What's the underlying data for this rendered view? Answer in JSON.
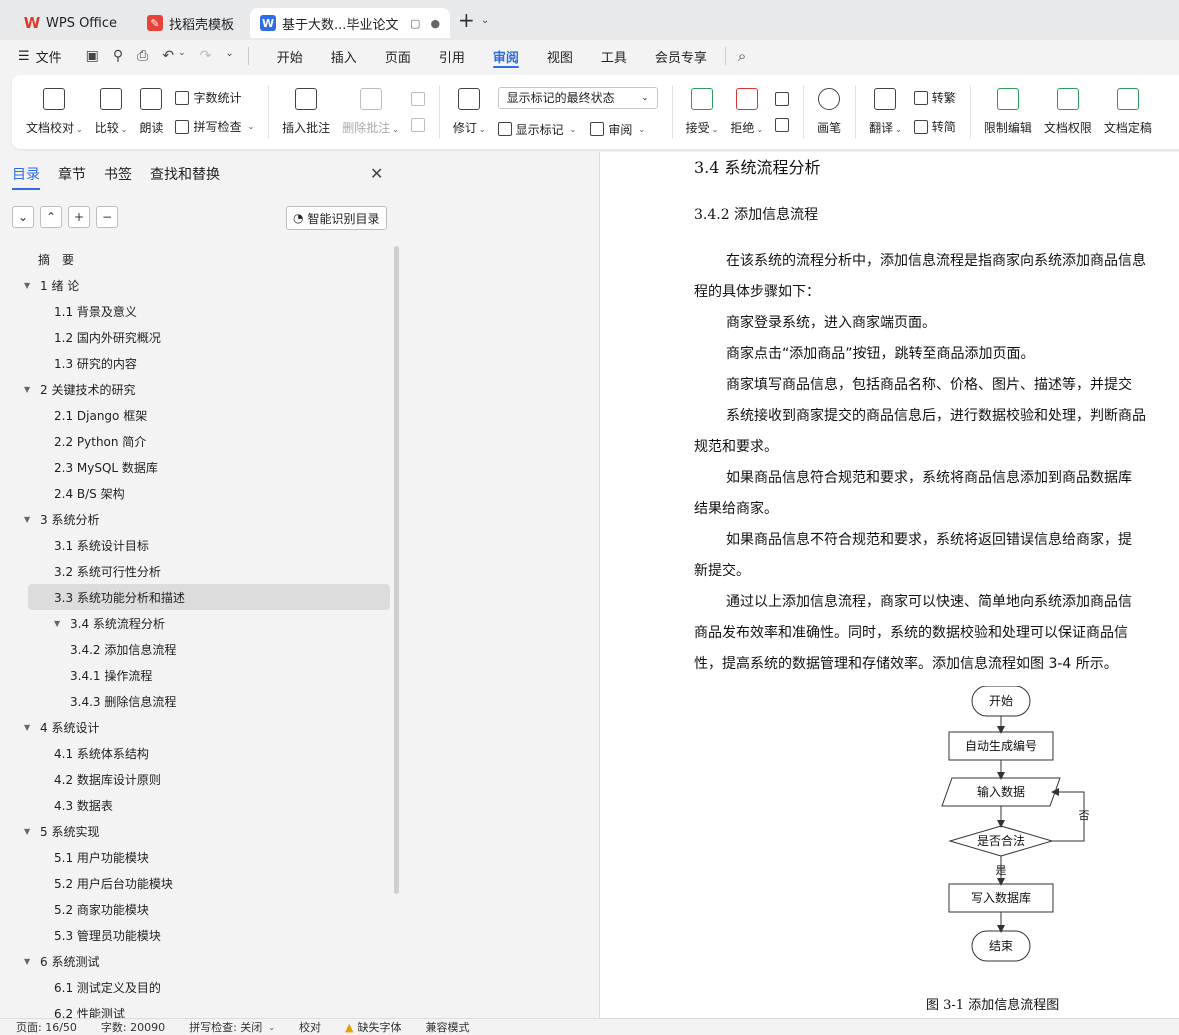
{
  "tabs": [
    {
      "label": "WPS Office",
      "icon": "wps-logo-icon"
    },
    {
      "label": "找稻壳模板",
      "icon": "docer-logo-icon"
    },
    {
      "label": "基于大数...毕业论文",
      "icon": "word-doc-icon"
    }
  ],
  "menu": {
    "file": "文件",
    "items": [
      "开始",
      "插入",
      "页面",
      "引用",
      "审阅",
      "视图",
      "工具",
      "会员专享"
    ],
    "active": "审阅"
  },
  "ribbon": {
    "doc_check": "文档校对",
    "compare": "比较",
    "read_aloud": "朗读",
    "word_count": "字数统计",
    "spell_check": "拼写检查",
    "insert_comment": "插入批注",
    "delete_comment": "删除批注",
    "revise": "修订",
    "markup_select": "显示标记的最终状态",
    "show_markup": "显示标记",
    "review": "审阅",
    "accept": "接受",
    "reject": "拒绝",
    "pen": "画笔",
    "translate": "翻译",
    "to_traditional": "转繁",
    "to_simplified": "转简",
    "restrict_edit": "限制编辑",
    "doc_permission": "文档权限",
    "doc_finalize": "文档定稿"
  },
  "sidepanel": {
    "tabs": [
      "目录",
      "章节",
      "书签",
      "查找和替换"
    ],
    "active_tab": "目录",
    "smart_toc": "智能识别目录",
    "toc": [
      {
        "label": "摘　要",
        "level": 1,
        "arrow": false
      },
      {
        "label": "1  绪 论",
        "level": 1,
        "arrow": true
      },
      {
        "label": "1.1 背景及意义",
        "level": 2
      },
      {
        "label": "1.2 国内外研究概况",
        "level": 2
      },
      {
        "label": "1.3 研究的内容",
        "level": 2
      },
      {
        "label": "2  关键技术的研究",
        "level": 1,
        "arrow": true
      },
      {
        "label": "2.1 Django 框架",
        "level": 2
      },
      {
        "label": "2.2 Python 简介",
        "level": 2
      },
      {
        "label": "2.3 MySQL 数据库",
        "level": 2
      },
      {
        "label": "2.4 B/S 架构",
        "level": 2
      },
      {
        "label": "3  系统分析",
        "level": 1,
        "arrow": true
      },
      {
        "label": "3.1  系统设计目标",
        "level": 2
      },
      {
        "label": "3.2  系统可行性分析",
        "level": 2
      },
      {
        "label": "3.3  系统功能分析和描述",
        "level": 2,
        "selected": true
      },
      {
        "label": "3.4 系统流程分析",
        "level": 2,
        "arrow": true
      },
      {
        "label": "3.4.2 添加信息流程",
        "level": 3
      },
      {
        "label": "3.4.1 操作流程",
        "level": 3
      },
      {
        "label": "3.4.3 删除信息流程",
        "level": 3
      },
      {
        "label": "4  系统设计",
        "level": 1,
        "arrow": true
      },
      {
        "label": "4.1  系统体系结构",
        "level": 2
      },
      {
        "label": "4.2  数据库设计原则",
        "level": 2
      },
      {
        "label": "4.3  数据表",
        "level": 2
      },
      {
        "label": "5  系统实现",
        "level": 1,
        "arrow": true
      },
      {
        "label": "5.1 用户功能模块",
        "level": 2
      },
      {
        "label": "5.2 用户后台功能模块",
        "level": 2
      },
      {
        "label": "5.2 商家功能模块",
        "level": 2
      },
      {
        "label": "5.3 管理员功能模块",
        "level": 2
      },
      {
        "label": "6  系统测试",
        "level": 1,
        "arrow": true
      },
      {
        "label": "6.1 测试定义及目的",
        "level": 2
      },
      {
        "label": "6.2 性能测试",
        "level": 2
      }
    ]
  },
  "document": {
    "heading": "3.4 系统流程分析",
    "subheading": "3.4.2 添加信息流程",
    "lines": [
      {
        "text": "在该系统的流程分析中，添加信息流程是指商家向系统添加商品信息",
        "indent": true
      },
      {
        "text": "程的具体步骤如下：",
        "indent": false
      },
      {
        "text": "商家登录系统，进入商家端页面。",
        "indent": true
      },
      {
        "text": "商家点击“添加商品”按钮，跳转至商品添加页面。",
        "indent": true
      },
      {
        "text": "商家填写商品信息，包括商品名称、价格、图片、描述等，并提交",
        "indent": true
      },
      {
        "text": "系统接收到商家提交的商品信息后，进行数据校验和处理，判断商品",
        "indent": true
      },
      {
        "text": "规范和要求。",
        "indent": false
      },
      {
        "text": "如果商品信息符合规范和要求，系统将商品信息添加到商品数据库",
        "indent": true
      },
      {
        "text": "结果给商家。",
        "indent": false
      },
      {
        "text": "如果商品信息不符合规范和要求，系统将返回错误信息给商家，提",
        "indent": true
      },
      {
        "text": "新提交。",
        "indent": false
      },
      {
        "text": "通过以上添加信息流程，商家可以快速、简单地向系统添加商品信",
        "indent": true
      },
      {
        "text": "商品发布效率和准确性。同时，系统的数据校验和处理可以保证商品信",
        "indent": false
      },
      {
        "text": "性，提高系统的数据管理和存储效率。添加信息流程如图 3-4 所示。",
        "indent": false
      }
    ],
    "flowchart": {
      "start": "开始",
      "auto_id": "自动生成编号",
      "input": "输入数据",
      "decision": "是否合法",
      "no": "否",
      "yes": "是",
      "write": "写入数据库",
      "end": "结束"
    },
    "figure_caption": "图 3-1  添加信息流程图"
  },
  "statusbar": {
    "page": "页面: 16/50",
    "words": "字数: 20090",
    "spell": "拼写检查: 关闭",
    "proof": "校对",
    "missing_font": "缺失字体",
    "compat": "兼容模式"
  },
  "colors": {
    "accent": "#2f6ce5",
    "selected_row": "#dcdcdc",
    "warning": "#e0a100"
  }
}
